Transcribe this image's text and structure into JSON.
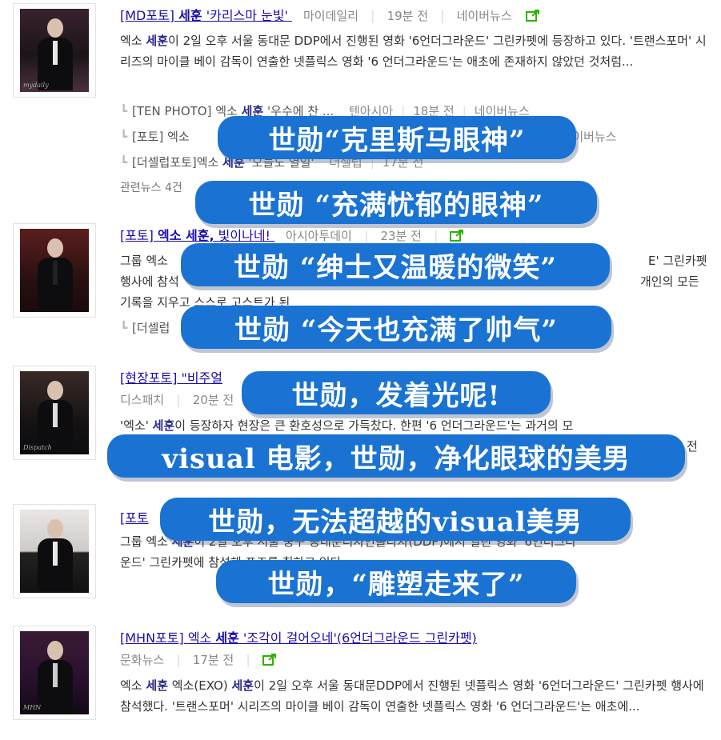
{
  "articles": [
    {
      "title_prefix": "[MD포토]",
      "title_keyword": "세훈",
      "title_suffix": "'카리스마 눈빛'",
      "source": "마이데일리",
      "time": "19분 전",
      "extra": "네이버뉴스",
      "snippet_pre": "엑소",
      "snippet_kw": "세훈",
      "snippet_post": "이 2일 오후 서울 동대문 DDP에서 진행된 영화 '6언더그라운드' 그린카펫에 등장하고 있다. '트랜스포머' 시리즈의 마이클 베이 감독이 연출한 넷플릭스 영화 '6 언더그라운드'는 애초에 존재하지 않았던 것처럼...",
      "thumb_wm": "mydaily",
      "related": [
        {
          "pre": "[TEN PHOTO]",
          "mid": "엑소",
          "kw": "세훈",
          "post": "'우수에 찬 ...",
          "source": "텐아시아",
          "time": "18분 전",
          "extra": "네이버뉴스"
        },
        {
          "pre": "[포토]",
          "mid": "엑소",
          "kw": "",
          "post": "",
          "source": "",
          "time": "",
          "extra": "네이버뉴스"
        },
        {
          "pre": "[더셀럽포토]",
          "mid": "엑소",
          "kw": "세훈",
          "post": "'오늘도 열일'",
          "source": "더셀럽",
          "time": "17분 전",
          "extra": ""
        }
      ],
      "more_label": "관련뉴스 4건"
    },
    {
      "title_prefix": "[포토]",
      "title_keyword": "엑소 세훈,",
      "title_suffix": "빛이나네!",
      "source": "아시아투데이",
      "time": "23분 전",
      "snippet_a": "그룹 엑소",
      "snippet_b": "E' 그린카펫",
      "snippet_c": "행사에 참석",
      "snippet_d": "개인의 모든",
      "snippet_e": "기록을 지우고 스스로 고스트가 된",
      "sub_label": "[더셀럽"
    },
    {
      "title_prefix": "[현장포토]",
      "title_suffix": "\"비주얼",
      "source": "디스패치",
      "time": "20분 전",
      "snippet_pre": "'엑소'",
      "snippet_kw": "세훈",
      "snippet_post": "이 등장하자 현장은 큰 환호성으로 가득찼다. 한편 '6 언더그라운드'는 과거의 모",
      "snippet_tail": "전",
      "thumb_wm": "Dispatch"
    },
    {
      "title_prefix": "[포토",
      "snippet_a": "그룹 엑소",
      "snippet_kw": "세훈",
      "snippet_b": "이 2일 오후 서울 중구 동대문디자인플라자(DDP)에서 열린 영화 '6언더그라",
      "snippet_c": "운드' 그린카펫에 참석해 포즈를 취하고 있다."
    },
    {
      "title_prefix": "[MHN포토]",
      "title_mid": "엑소",
      "title_keyword": "세훈",
      "title_suffix": "'조각이 걸어오네'(6언더그라운드 그린카펫)",
      "source": "문화뉴스",
      "time": "17분 전",
      "snippet_pre": "엑소",
      "snippet_kw1": "세훈",
      "snippet_mid": "엑소(EXO)",
      "snippet_kw2": "세훈",
      "snippet_post": "이 2일 오후 서울 동대문DDP에서 진행된 넷플릭스 영화 '6언더그라운드' 그린카펫 행사에 참석했다. '트랜스포머' 시리즈의 마이클 베이 감독이 연출한 넷플릭스 영화 '6 언더그라운드'는 애초에...",
      "thumb_wm": "MHN"
    }
  ],
  "captions": [
    "世勋“克里斯马眼神”",
    "世勋 “充满忧郁的眼神”",
    "世勋 “绅士又温暖的微笑”",
    "世勋 “今天也充满了帅气”",
    "世勋，发着光呢!",
    "visual 电影，世勋，净化眼球的美男",
    "世勋，无法超越的visual美男",
    "世勋，“雕塑走来了”"
  ],
  "colors": {
    "link": "#1a0dab",
    "bubble": "#1a73d2",
    "share_icon": "#2db400"
  }
}
